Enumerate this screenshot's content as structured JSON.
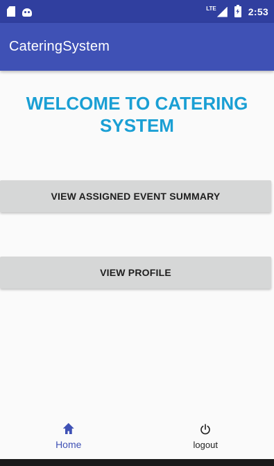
{
  "status_bar": {
    "network_label": "LTE",
    "time": "2:53"
  },
  "app_bar": {
    "title": "CateringSystem"
  },
  "main": {
    "welcome_line1": "WELCOME TO CATERING",
    "welcome_line2": "SYSTEM",
    "view_events_label": "VIEW ASSIGNED EVENT SUMMARY",
    "view_profile_label": "VIEW PROFILE"
  },
  "bottom_nav": {
    "items": [
      {
        "label": "Home",
        "icon": "home-icon",
        "active": true
      },
      {
        "label": "logout",
        "icon": "power-icon",
        "active": false
      }
    ]
  },
  "colors": {
    "status_bar": "#303f9f",
    "primary": "#3f51b5",
    "welcome_text": "#1a9fd4",
    "button_bg": "#d6d7d7"
  }
}
